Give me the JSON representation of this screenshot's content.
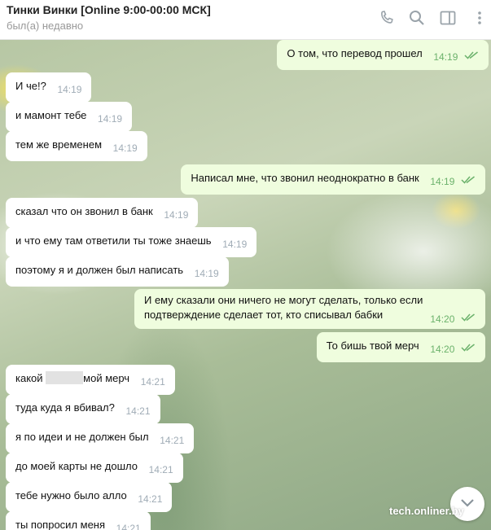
{
  "header": {
    "title": "Тинки Винки [Online 9:00-00:00 МСК]",
    "status": "был(а) недавно",
    "icons": [
      "phone-icon",
      "search-icon",
      "sidebar-toggle-icon",
      "more-icon"
    ]
  },
  "colors": {
    "incoming_bubble": "#ffffff",
    "outgoing_bubble": "#effdde",
    "outgoing_time": "#6cb26c",
    "incoming_time": "#a0acb6"
  },
  "messages": [
    {
      "dir": "out",
      "text": "О том, что перевод прошел",
      "time": "14:19"
    },
    {
      "dir": "in",
      "text": "И че!?",
      "time": "14:19"
    },
    {
      "dir": "in",
      "text": "и мамонт тебе",
      "time": "14:19"
    },
    {
      "dir": "in",
      "text": "тем же временем",
      "time": "14:19"
    },
    {
      "dir": "out",
      "text": "Написал мне, что звонил неоднократно в банк",
      "time": "14:19"
    },
    {
      "dir": "in",
      "text": "сказал что он звонил в банк",
      "time": "14:19"
    },
    {
      "dir": "in",
      "text": "и что ему там ответили ты тоже знаешь",
      "time": "14:19"
    },
    {
      "dir": "in",
      "text": "поэтому я и должен был написать",
      "time": "14:19"
    },
    {
      "dir": "out",
      "text_line1": "И ему сказали они ничего не могут сделать, только если",
      "text_line2": "подтверждение сделает тот, кто списывал бабки",
      "time": "14:20"
    },
    {
      "dir": "out",
      "text": "То бишь твой мерч",
      "time": "14:20"
    },
    {
      "dir": "in",
      "text_before": "какой",
      "text_after": "мой мерч",
      "time": "14:21"
    },
    {
      "dir": "in",
      "text": "туда куда я вбивал?",
      "time": "14:21"
    },
    {
      "dir": "in",
      "text": "я по идеи и не должен был",
      "time": "14:21"
    },
    {
      "dir": "in",
      "text": "до моей карты не дошло",
      "time": "14:21"
    },
    {
      "dir": "in",
      "text": "тебе нужно было алло",
      "time": "14:21"
    },
    {
      "dir": "in",
      "text": "ты попросил меня",
      "time": "14:21"
    }
  ],
  "watermark": "tech.onliner.by"
}
